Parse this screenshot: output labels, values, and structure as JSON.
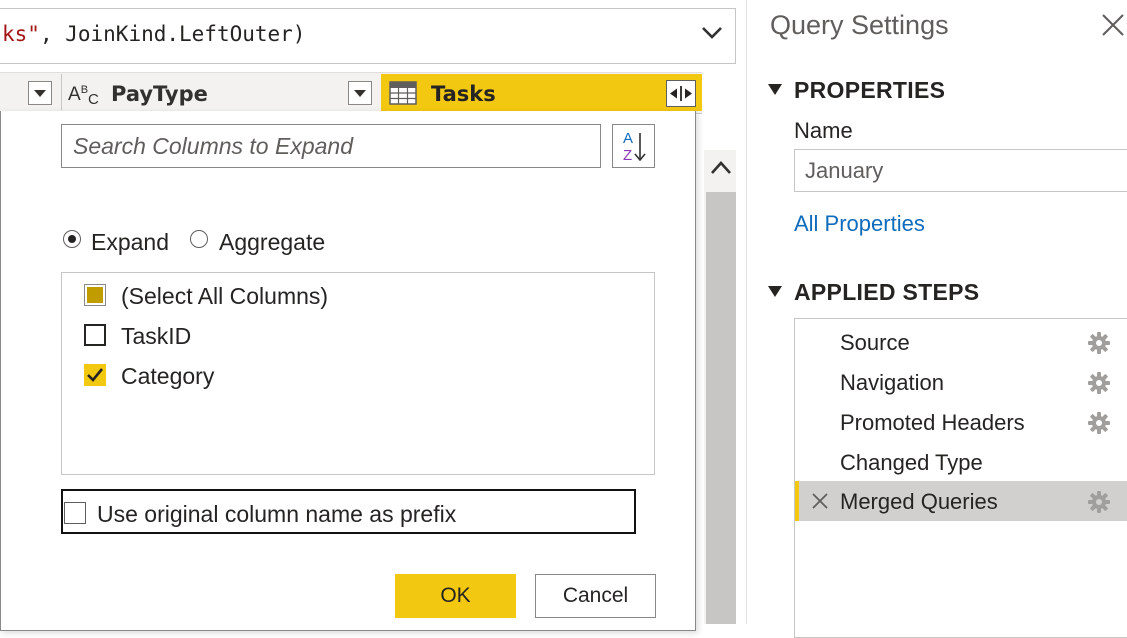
{
  "formula": {
    "text_str": "ks\"",
    "text_rest": ", JoinKind.LeftOuter)"
  },
  "columns": {
    "paytype": {
      "type_icon": "text-abc-icon",
      "type_A": "A",
      "type_B": "B",
      "type_C": "C",
      "label": "PayType"
    },
    "tasks": {
      "icon": "table-icon",
      "label": "Tasks"
    }
  },
  "expand_dialog": {
    "search_placeholder": "Search Columns to Expand",
    "sort_icon": "sort-az-icon",
    "modes": [
      {
        "label": "Expand",
        "selected": true
      },
      {
        "label": "Aggregate",
        "selected": false
      }
    ],
    "column_items": [
      {
        "label": "(Select All Columns)",
        "state": "indeterminate"
      },
      {
        "label": "TaskID",
        "state": "unchecked"
      },
      {
        "label": "Category",
        "state": "checked"
      }
    ],
    "prefix_option": {
      "label": "Use original column name as prefix",
      "checked": false
    },
    "ok_label": "OK",
    "cancel_label": "Cancel"
  },
  "query_settings": {
    "title": "Query Settings",
    "properties_title": "PROPERTIES",
    "name_label": "Name",
    "name_value": "January",
    "all_properties_label": "All Properties",
    "applied_steps_title": "APPLIED STEPS",
    "steps": [
      {
        "label": "Source",
        "has_gear": true,
        "selected": false
      },
      {
        "label": "Navigation",
        "has_gear": true,
        "selected": false
      },
      {
        "label": "Promoted Headers",
        "has_gear": true,
        "selected": false
      },
      {
        "label": "Changed Type",
        "has_gear": false,
        "selected": false
      },
      {
        "label": "Merged Queries",
        "has_gear": true,
        "selected": true
      }
    ]
  },
  "colors": {
    "accent": "#f2c811",
    "link": "#0f6cbd",
    "string": "#a31515"
  }
}
